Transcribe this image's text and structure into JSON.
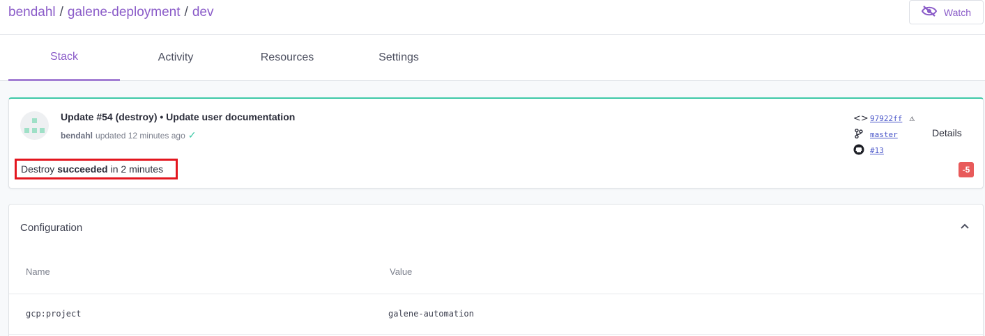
{
  "breadcrumb": {
    "org": "bendahl",
    "sep1": "/",
    "project": "galene-deployment",
    "sep2": "/",
    "stack": "dev"
  },
  "watch": {
    "label": "Watch",
    "icon": "eye-off-icon"
  },
  "tabs": [
    {
      "label": "Stack",
      "active": true
    },
    {
      "label": "Activity",
      "active": false
    },
    {
      "label": "Resources",
      "active": false
    },
    {
      "label": "Settings",
      "active": false
    }
  ],
  "update": {
    "title": "Update #54 (destroy) • Update user documentation",
    "user": "bendahl",
    "time_text": "updated 12 minutes ago",
    "result_prefix": "Destroy",
    "result_status": "succeeded",
    "result_suffix": "in 2 minutes",
    "commit": "97922ff",
    "branch": "master",
    "pr": "#13",
    "details_label": "Details",
    "delta": "-5"
  },
  "configuration": {
    "title": "Configuration",
    "columns": [
      "Name",
      "Value"
    ],
    "rows": [
      {
        "name": "gcp:project",
        "value": "galene-automation"
      }
    ]
  },
  "colors": {
    "accent": "#8a5bc8",
    "success": "#3ec9a7",
    "danger": "#e85a5a",
    "highlight": "#e3161f"
  }
}
